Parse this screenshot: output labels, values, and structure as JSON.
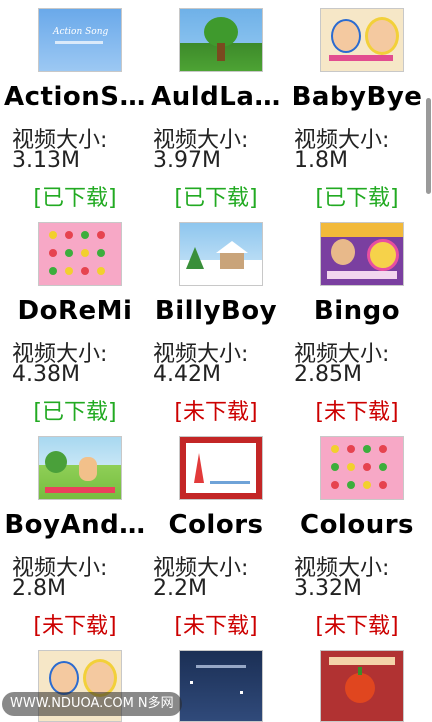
{
  "size_label": "视频大小:",
  "watermark": "WWW.NDUOA.COM N多网",
  "videos": [
    {
      "title": "ActionS…",
      "size": "3.13M",
      "status": "[已下载]",
      "thumb_text": "Action Song"
    },
    {
      "title": "AuldLa…",
      "size": "3.97M",
      "status": "[已下载]"
    },
    {
      "title": "BabyBye",
      "size": "1.8M",
      "status": "[已下载]"
    },
    {
      "title": "DoReMi",
      "size": "4.38M",
      "status": "[已下载]"
    },
    {
      "title": "BillyBoy",
      "size": "4.42M",
      "status": "[未下载]"
    },
    {
      "title": "Bingo",
      "size": "2.85M",
      "status": "[未下载]"
    },
    {
      "title": "BoyAnd…",
      "size": "2.8M",
      "status": "[未下载]"
    },
    {
      "title": "Colors",
      "size": "2.2M",
      "status": "[未下载]"
    },
    {
      "title": "Colours",
      "size": "3.32M",
      "status": "[未下载]"
    }
  ],
  "colors": {
    "downloaded": "#22aa22",
    "not_downloaded": "#cc0000"
  }
}
